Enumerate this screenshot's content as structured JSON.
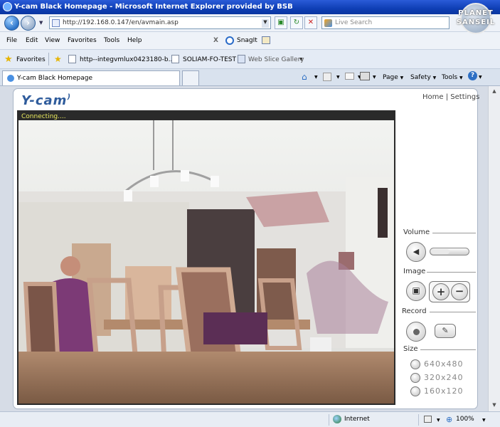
{
  "window": {
    "title": "Y-cam Black Homepage - Microsoft Internet Explorer provided by BSB"
  },
  "corner_logo": {
    "line1": "PLANET",
    "line2": "SANSEIL"
  },
  "address": {
    "url": "http://192.168.0.147/en/avmain.asp"
  },
  "search": {
    "placeholder": "Live Search"
  },
  "menu": {
    "items": [
      "File",
      "Edit",
      "View",
      "Favorites",
      "Tools",
      "Help"
    ],
    "x_label": "X",
    "snagit_label": "SnagIt"
  },
  "favorites": {
    "label": "Favorites",
    "items": [
      "http--integvmlux0423180-b...",
      "SOLIAM-FO-TEST",
      "Web Slice Gallery"
    ]
  },
  "tabs": [
    {
      "label": "Y-cam Black Homepage"
    }
  ],
  "commandbar": {
    "page": "Page",
    "safety": "Safety",
    "tools": "Tools"
  },
  "app": {
    "logo": "Y-cam",
    "links": {
      "home": "Home",
      "separator": "|",
      "settings": "Settings"
    },
    "status": "Connecting....",
    "sections": {
      "volume": "Volume",
      "image": "Image",
      "record": "Record",
      "size": "Size"
    },
    "volume_level": 0.5,
    "size_options": [
      "640x480",
      "320x240",
      "160x120"
    ]
  },
  "statusbar": {
    "zone": "Internet",
    "zoom": "100%"
  },
  "colors": {
    "title_bar": "#0f3fb5",
    "status_text": "#e8e85c",
    "logo": "#2f5c9c"
  }
}
